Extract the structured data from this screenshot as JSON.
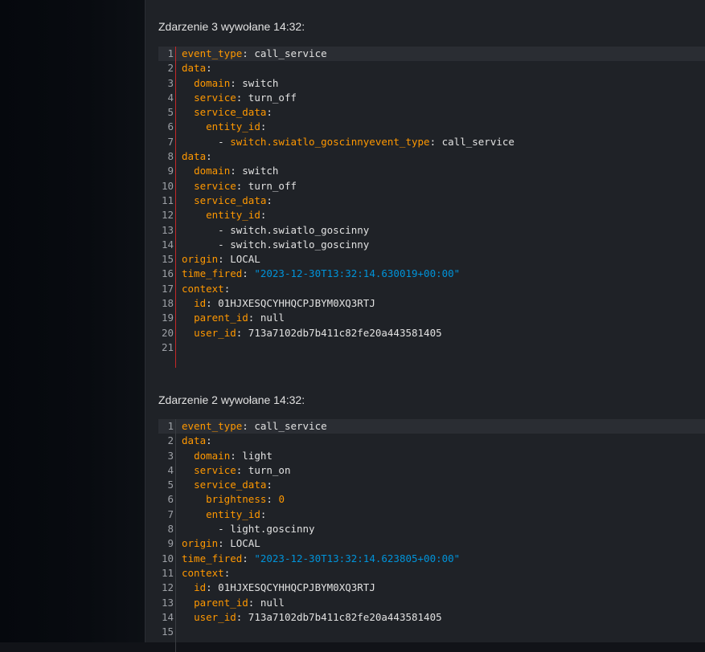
{
  "colors": {
    "background": "#1f2227",
    "sidebar": "#05080d",
    "key": "#ff9800",
    "string": "#0093d9",
    "text": "#e1e1e1",
    "line_number": "#9da0a6",
    "gutter_error": "#c62828",
    "gutter_normal": "#3a3d42"
  },
  "events": [
    {
      "title": "Zdarzenie 3 wywołane 14:32:",
      "gutter": "error",
      "lines": [
        [
          [
            "k",
            "event_type"
          ],
          [
            "t",
            ": call_service"
          ]
        ],
        [
          [
            "k",
            "data"
          ],
          [
            "t",
            ":"
          ]
        ],
        [
          [
            "t",
            "  "
          ],
          [
            "k",
            "domain"
          ],
          [
            "t",
            ": switch"
          ]
        ],
        [
          [
            "t",
            "  "
          ],
          [
            "k",
            "service"
          ],
          [
            "t",
            ": turn_off"
          ]
        ],
        [
          [
            "t",
            "  "
          ],
          [
            "k",
            "service_data"
          ],
          [
            "t",
            ":"
          ]
        ],
        [
          [
            "t",
            "    "
          ],
          [
            "k",
            "entity_id"
          ],
          [
            "t",
            ":"
          ]
        ],
        [
          [
            "t",
            "      - "
          ],
          [
            "k",
            "switch.swiatlo_goscinnyevent_type"
          ],
          [
            "t",
            ": call_service"
          ]
        ],
        [
          [
            "k",
            "data"
          ],
          [
            "t",
            ":"
          ]
        ],
        [
          [
            "t",
            "  "
          ],
          [
            "k",
            "domain"
          ],
          [
            "t",
            ": switch"
          ]
        ],
        [
          [
            "t",
            "  "
          ],
          [
            "k",
            "service"
          ],
          [
            "t",
            ": turn_off"
          ]
        ],
        [
          [
            "t",
            "  "
          ],
          [
            "k",
            "service_data"
          ],
          [
            "t",
            ":"
          ]
        ],
        [
          [
            "t",
            "    "
          ],
          [
            "k",
            "entity_id"
          ],
          [
            "t",
            ":"
          ]
        ],
        [
          [
            "t",
            "      - switch.swiatlo_goscinny"
          ]
        ],
        [
          [
            "t",
            "      - switch.swiatlo_goscinny"
          ]
        ],
        [
          [
            "k",
            "origin"
          ],
          [
            "t",
            ": LOCAL"
          ]
        ],
        [
          [
            "k",
            "time_fired"
          ],
          [
            "t",
            ": "
          ],
          [
            "s",
            "\"2023-12-30T13:32:14.630019+00:00\""
          ]
        ],
        [
          [
            "k",
            "context"
          ],
          [
            "t",
            ":"
          ]
        ],
        [
          [
            "t",
            "  "
          ],
          [
            "k",
            "id"
          ],
          [
            "t",
            ": 01HJXESQCYHHQCPJBYM0XQ3RTJ"
          ]
        ],
        [
          [
            "t",
            "  "
          ],
          [
            "k",
            "parent_id"
          ],
          [
            "t",
            ": null"
          ]
        ],
        [
          [
            "t",
            "  "
          ],
          [
            "k",
            "user_id"
          ],
          [
            "t",
            ": 713a7102db7b411c82fe20a443581405"
          ]
        ],
        []
      ]
    },
    {
      "title": "Zdarzenie 2 wywołane 14:32:",
      "gutter": "normal",
      "lines": [
        [
          [
            "k",
            "event_type"
          ],
          [
            "t",
            ": call_service"
          ]
        ],
        [
          [
            "k",
            "data"
          ],
          [
            "t",
            ":"
          ]
        ],
        [
          [
            "t",
            "  "
          ],
          [
            "k",
            "domain"
          ],
          [
            "t",
            ": light"
          ]
        ],
        [
          [
            "t",
            "  "
          ],
          [
            "k",
            "service"
          ],
          [
            "t",
            ": turn_on"
          ]
        ],
        [
          [
            "t",
            "  "
          ],
          [
            "k",
            "service_data"
          ],
          [
            "t",
            ":"
          ]
        ],
        [
          [
            "t",
            "    "
          ],
          [
            "k",
            "brightness"
          ],
          [
            "t",
            ": "
          ],
          [
            "n",
            "0"
          ]
        ],
        [
          [
            "t",
            "    "
          ],
          [
            "k",
            "entity_id"
          ],
          [
            "t",
            ":"
          ]
        ],
        [
          [
            "t",
            "      - light.goscinny"
          ]
        ],
        [
          [
            "k",
            "origin"
          ],
          [
            "t",
            ": LOCAL"
          ]
        ],
        [
          [
            "k",
            "time_fired"
          ],
          [
            "t",
            ": "
          ],
          [
            "s",
            "\"2023-12-30T13:32:14.623805+00:00\""
          ]
        ],
        [
          [
            "k",
            "context"
          ],
          [
            "t",
            ":"
          ]
        ],
        [
          [
            "t",
            "  "
          ],
          [
            "k",
            "id"
          ],
          [
            "t",
            ": 01HJXESQCYHHQCPJBYM0XQ3RTJ"
          ]
        ],
        [
          [
            "t",
            "  "
          ],
          [
            "k",
            "parent_id"
          ],
          [
            "t",
            ": null"
          ]
        ],
        [
          [
            "t",
            "  "
          ],
          [
            "k",
            "user_id"
          ],
          [
            "t",
            ": 713a7102db7b411c82fe20a443581405"
          ]
        ],
        []
      ]
    }
  ]
}
